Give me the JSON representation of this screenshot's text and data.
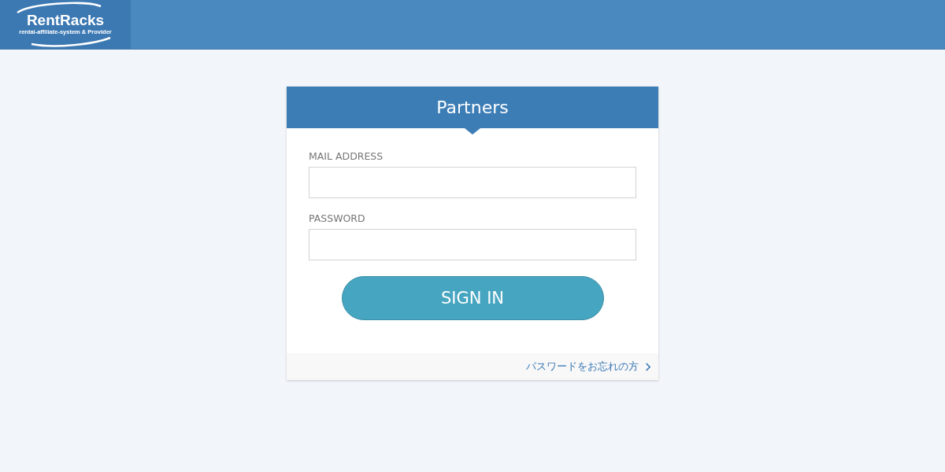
{
  "header": {
    "logo": {
      "name": "RentRacks",
      "tagline": "rental-affiliate-system & Provider"
    }
  },
  "login": {
    "title": "Partners",
    "fields": [
      {
        "label": "MAIL ADDRESS"
      },
      {
        "label": "PASSWORD"
      }
    ],
    "submit": "SIGN IN",
    "forgot_link": "パスワードをお忘れの方"
  }
}
